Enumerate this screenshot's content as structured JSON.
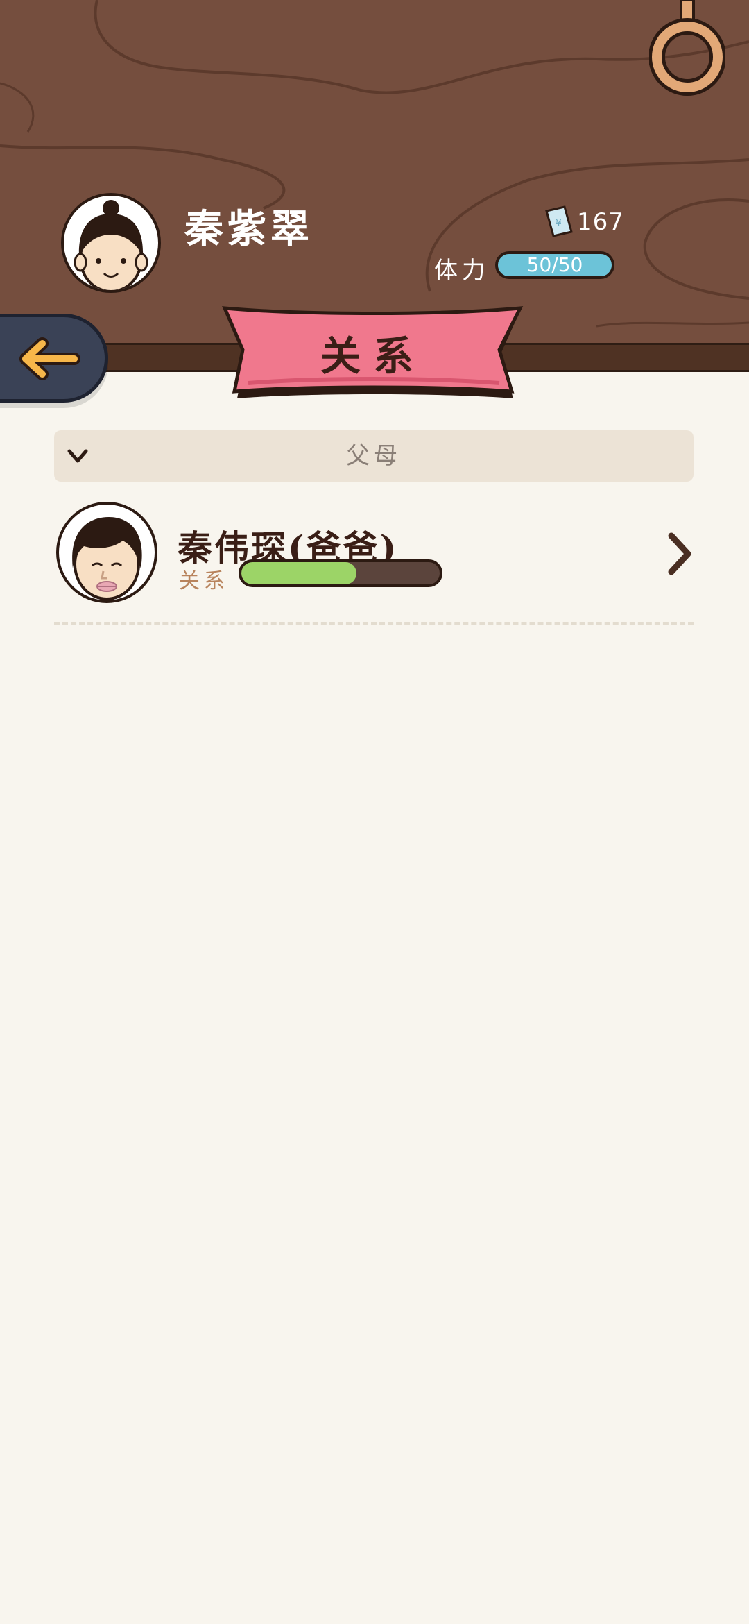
{
  "player": {
    "name": "秦紫翠",
    "money_value": "167",
    "stamina_label": "体力",
    "stamina_value": "50/50",
    "stamina_fraction": 1.0
  },
  "page": {
    "title": "关系"
  },
  "section": {
    "title": "父母"
  },
  "relations": [
    {
      "name": "秦伟琛(爸爸)",
      "relation_label": "关系",
      "relation_fraction": 0.58
    }
  ],
  "colors": {
    "wood": "#754e3e",
    "ribbon": "#f0788d",
    "stamina_bar": "#6cc3d8",
    "relation_fill": "#9cd467",
    "back_button": "#3a4256",
    "background": "#f8f5ee"
  },
  "icons": {
    "back": "arrow-left-icon",
    "money": "banknote-icon",
    "section_toggle": "chevron-down-icon",
    "row_open": "chevron-right-icon",
    "ring": "ring-icon"
  }
}
